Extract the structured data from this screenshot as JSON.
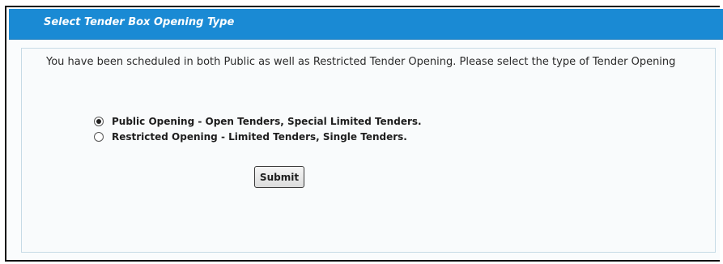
{
  "panel": {
    "title": "Select Tender Box Opening Type",
    "message": "You have been scheduled in both Public as well as Restricted Tender Opening. Please select the type of Tender Opening"
  },
  "options": [
    {
      "label": "Public Opening - Open Tenders, Special Limited Tenders.",
      "selected": true
    },
    {
      "label": "Restricted Opening - Limited Tenders, Single Tenders.",
      "selected": false
    }
  ],
  "actions": {
    "submit_label": "Submit"
  },
  "colors": {
    "header_blue": "#1a8ad4",
    "body_background": "#f9fbfc"
  }
}
